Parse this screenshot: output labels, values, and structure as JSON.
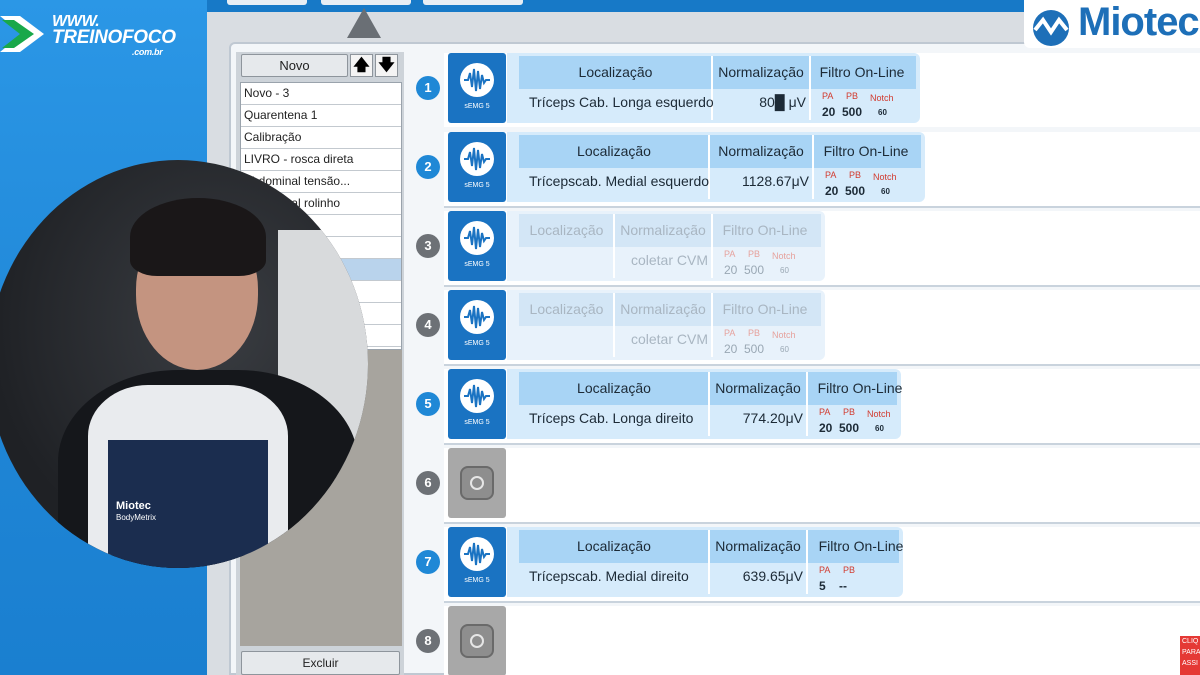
{
  "stream_logo": {
    "line1": "WWW.",
    "line2": "TREINO",
    "line3": "FOCO",
    "line4": ".com.br"
  },
  "brand": {
    "name": "Miotec"
  },
  "left_panel": {
    "novo_label": "Novo",
    "up_label": "🡅",
    "down_label": "🡇",
    "items": [
      "Novo - 3",
      "Quarentena 1",
      "Calibração",
      "LIVRO - rosca direta",
      "Abdominal tensão...",
      "Abdominal rolinho",
      "",
      "",
      "",
      "",
      "",
      ""
    ],
    "excluir_label": "Excluir"
  },
  "channels": [
    {
      "number": "1",
      "active": true,
      "sensor_label": "sEMG 5",
      "headers": {
        "loc": "Localização",
        "norm": "Normalização",
        "filter": "Filtro On-Line"
      },
      "location": "Tríceps Cab. Longa esquerdo",
      "normalization": "80█ μV",
      "pa_label": "PA",
      "pb_label": "PB",
      "notch_label": "Notch",
      "pa": "20",
      "pb": "500",
      "notch": "60"
    },
    {
      "number": "2",
      "active": true,
      "sensor_label": "sEMG 5",
      "headers": {
        "loc": "Localização",
        "norm": "Normalização",
        "filter": "Filtro On-Line"
      },
      "location": "Trícepscab. Medial esquerdo",
      "normalization": "1128.67μV",
      "pa_label": "PA",
      "pb_label": "PB",
      "notch_label": "Notch",
      "pa": "20",
      "pb": "500",
      "notch": "60"
    },
    {
      "number": "3",
      "active": false,
      "sensor_label": "sEMG 5",
      "headers": {
        "loc": "Localização",
        "norm": "Normalização",
        "filter": "Filtro On-Line"
      },
      "location": "",
      "normalization": "coletar CVM",
      "pa_label": "PA",
      "pb_label": "PB",
      "notch_label": "Notch",
      "pa": "20",
      "pb": "500",
      "notch": "60"
    },
    {
      "number": "4",
      "active": false,
      "sensor_label": "sEMG 5",
      "headers": {
        "loc": "Localização",
        "norm": "Normalização",
        "filter": "Filtro On-Line"
      },
      "location": "",
      "normalization": "coletar CVM",
      "pa_label": "PA",
      "pb_label": "PB",
      "notch_label": "Notch",
      "pa": "20",
      "pb": "500",
      "notch": "60"
    },
    {
      "number": "5",
      "active": true,
      "sensor_label": "sEMG 5",
      "headers": {
        "loc": "Localização",
        "norm": "Normalização",
        "filter": "Filtro On-Line"
      },
      "location": "Tríceps Cab. Longa direito",
      "normalization": "774.20μV",
      "pa_label": "PA",
      "pb_label": "PB",
      "notch_label": "Notch",
      "pa": "20",
      "pb": "500",
      "notch": "60"
    },
    {
      "number": "6",
      "empty": true
    },
    {
      "number": "7",
      "active": true,
      "sensor_label": "sEMG 5",
      "headers": {
        "loc": "Localização",
        "norm": "Normalização",
        "filter": "Filtro On-Line"
      },
      "location": "Trícepscab. Medial direito",
      "normalization": "639.65μV",
      "pa_label": "PA",
      "pb_label": "PB",
      "notch_label": "",
      "pa": "5",
      "pb": "--",
      "notch": ""
    },
    {
      "number": "8",
      "empty": true
    }
  ],
  "webcam": {
    "shirt_brand": "Miotec",
    "shirt_sub": "BodyMetrix"
  },
  "yt": {
    "line1": "CLIQ",
    "line2": "PARA",
    "line3": "ASSI"
  }
}
